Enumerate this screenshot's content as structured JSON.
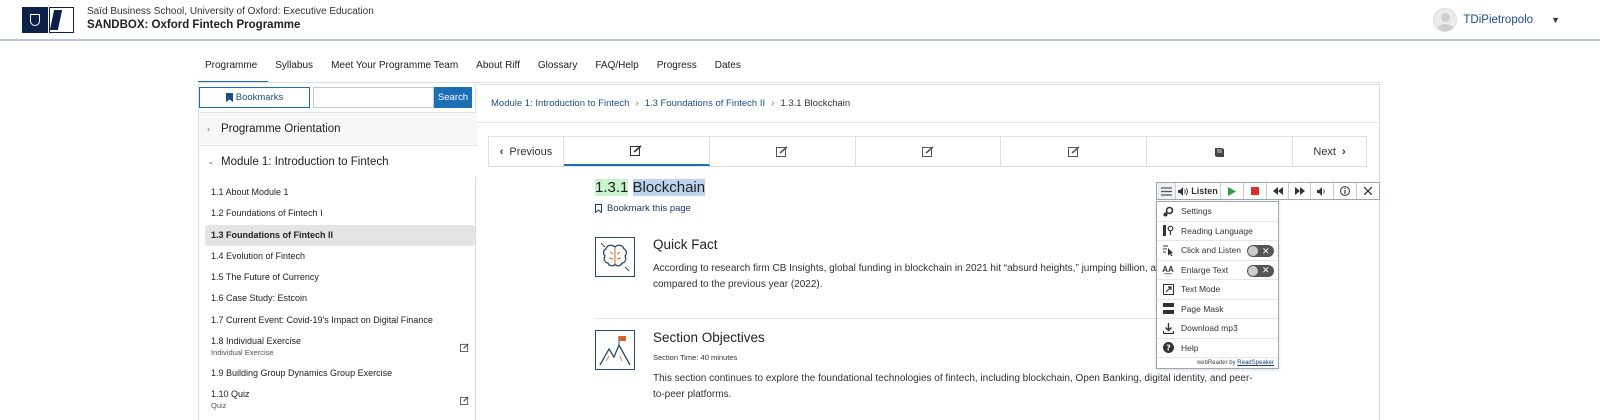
{
  "header": {
    "org": "Saïd Business School, University of Oxford: Executive Education",
    "programme": "SANDBOX: Oxford Fintech Programme",
    "username": "TDiPietropolo"
  },
  "nav": {
    "tabs": [
      "Programme",
      "Syllabus",
      "Meet Your Programme Team",
      "About Riff",
      "Glossary",
      "FAQ/Help",
      "Progress",
      "Dates"
    ],
    "active": "Programme"
  },
  "sidebar": {
    "bookmarks_label": "Bookmarks",
    "search_placeholder": "",
    "search_button": "Search",
    "sections": [
      "Programme Orientation",
      "Module 1: Introduction to Fintech"
    ],
    "items": [
      {
        "label": "1.1 About Module 1"
      },
      {
        "label": "1.2 Foundations of Fintech I"
      },
      {
        "label": "1.3 Foundations of Fintech II"
      },
      {
        "label": "1.4 Evolution of Fintech"
      },
      {
        "label": "1.5 The Future of Currency"
      },
      {
        "label": "1.6 Case Study: Estcoin"
      },
      {
        "label": "1.7 Current Event: Covid-19's Impact on Digital Finance"
      },
      {
        "label": "1.8 Individual Exercise",
        "sub": "Individual Exercise"
      },
      {
        "label": "1.9 Building Group Dynamics Group Exercise"
      },
      {
        "label": "1.10 Quiz",
        "sub": "Quiz"
      }
    ]
  },
  "breadcrumb": [
    "Module 1: Introduction to Fintech",
    "1.3 Foundations of Fintech II",
    "1.3.1 Blockchain"
  ],
  "pager": {
    "previous": "Previous",
    "next": "Next"
  },
  "page": {
    "title_num": "1.3.1",
    "title_word": "Blockchain",
    "bookmark_link": "Bookmark this page",
    "quick_fact_title": "Quick Fact",
    "quick_fact_text": "According to research firm CB Insights, global funding in blockchain in 2021 hit “absurd heights,” jumping billion, a 700% growth compared to the previous year (2022).",
    "objectives_title": "Section Objectives",
    "section_time": "Section Time: 40 minutes",
    "objectives_text": "This section continues to explore the foundational technologies of fintech, including blockchain, Open Banking, digital identity, and peer-to-peer platforms."
  },
  "readspeaker": {
    "listen": "Listen",
    "menu": [
      "Settings",
      "Reading Language",
      "Click and Listen",
      "Enlarge Text",
      "Text Mode",
      "Page Mask",
      "Download mp3",
      "Help"
    ],
    "footer_prefix": "webReader by",
    "footer_brand": "ReadSpeaker"
  },
  "colors": {
    "accent": "#1a6fb5",
    "link": "#1a4f8a",
    "highlight_green": "#c9f2cf",
    "highlight_blue": "#bcd4f0",
    "stop_red": "#d9302c",
    "play_green": "#2e9e3a"
  }
}
